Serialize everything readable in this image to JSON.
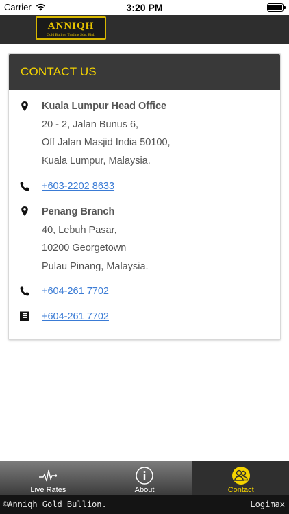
{
  "status_bar": {
    "carrier": "Carrier",
    "time": "3:20 PM",
    "icons": [
      "wifi-icon",
      "battery-icon"
    ]
  },
  "header": {
    "logo_text": "ANNIQH",
    "logo_subtitle": "Gold Bullion Trading Sdn. Bhd."
  },
  "contact": {
    "title": "CONTACT US",
    "kl_office": {
      "name": "Kuala Lumpur Head Office",
      "address_line1": "20 - 2, Jalan Bunus 6,",
      "address_line2": "Off Jalan Masjid India 50100,",
      "address_line3": "Kuala Lumpur, Malaysia.",
      "phone": "+603-2202 8633"
    },
    "penang_branch": {
      "name": "Penang Branch",
      "address_line1": "40, Lebuh Pasar,",
      "address_line2": "10200 Georgetown",
      "address_line3": "Pulau Pinang, Malaysia.",
      "phone": "+604-261 7702",
      "fax": "+604-261 7702"
    }
  },
  "tabs": [
    {
      "label": "Live Rates",
      "icon": "pulse-icon",
      "active": false
    },
    {
      "label": "About",
      "icon": "info-icon",
      "active": false
    },
    {
      "label": "Contact",
      "icon": "contacts-icon",
      "active": true
    }
  ],
  "footer": {
    "copyright": "©Anniqh Gold Bullion.",
    "brand": "Logimax"
  },
  "colors": {
    "accent": "#f4d300",
    "header_bg": "#2e2e2e",
    "card_header_bg": "#393939",
    "link": "#3a7bd5"
  }
}
